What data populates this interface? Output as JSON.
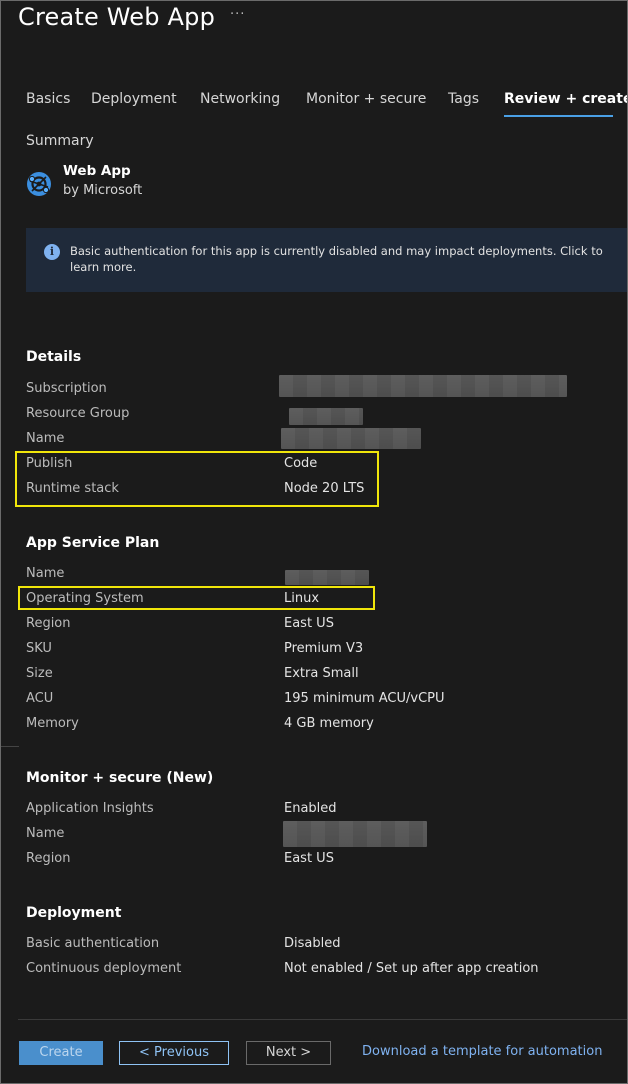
{
  "header": {
    "title": "Create Web App",
    "more_label": "···"
  },
  "tabs": [
    {
      "label": "Basics"
    },
    {
      "label": "Deployment"
    },
    {
      "label": "Networking"
    },
    {
      "label": "Monitor + secure"
    },
    {
      "label": "Tags"
    },
    {
      "label": "Review + create",
      "active": true
    }
  ],
  "summary": {
    "label": "Summary",
    "product_name": "Web App",
    "product_by": "by Microsoft",
    "icon": "web-app-icon"
  },
  "info_banner": {
    "icon": "info-icon",
    "icon_glyph": "i",
    "text": "Basic authentication for this app is currently disabled and may impact deployments. Click to learn more."
  },
  "details": {
    "title": "Details",
    "rows": [
      {
        "label": "Subscription",
        "value": ""
      },
      {
        "label": "Resource Group",
        "value": ""
      },
      {
        "label": "Name",
        "value": ""
      },
      {
        "label": "Publish",
        "value": "Code"
      },
      {
        "label": "Runtime stack",
        "value": "Node 20 LTS"
      }
    ]
  },
  "app_service_plan": {
    "title": "App Service Plan",
    "rows": [
      {
        "label": "Name",
        "value": ""
      },
      {
        "label": "Operating System",
        "value": "Linux"
      },
      {
        "label": "Region",
        "value": "East US"
      },
      {
        "label": "SKU",
        "value": "Premium V3"
      },
      {
        "label": "Size",
        "value": "Extra Small"
      },
      {
        "label": "ACU",
        "value": "195 minimum ACU/vCPU"
      },
      {
        "label": "Memory",
        "value": "4 GB memory"
      }
    ]
  },
  "monitor": {
    "title": "Monitor + secure (New)",
    "rows": [
      {
        "label": "Application Insights",
        "value": "Enabled"
      },
      {
        "label": "Name",
        "value": ""
      },
      {
        "label": "Region",
        "value": "East US"
      }
    ]
  },
  "deployment": {
    "title": "Deployment",
    "rows": [
      {
        "label": "Basic authentication",
        "value": "Disabled"
      },
      {
        "label": "Continuous deployment",
        "value": "Not enabled / Set up after app creation"
      }
    ]
  },
  "footer": {
    "create_label": "Create",
    "previous_label": "< Previous",
    "next_label": "Next >",
    "download_link": "Download a template for automation"
  },
  "colors": {
    "background": "#1b1b1b",
    "accent": "#4aa0e6",
    "highlight": "#f0e60a",
    "link": "#7fb2f0"
  }
}
